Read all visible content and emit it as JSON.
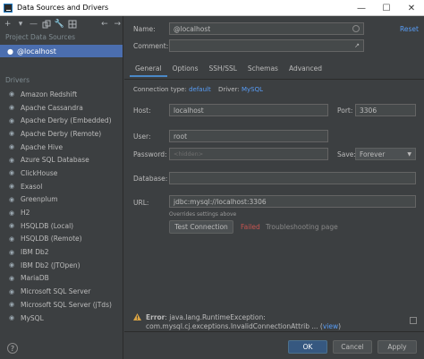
{
  "window": {
    "title": "Data Sources and Drivers"
  },
  "sidebar": {
    "project_label": "Project Data Sources",
    "project_item": "@localhost",
    "drivers_label": "Drivers",
    "drivers": [
      "Amazon Redshift",
      "Apache Cassandra",
      "Apache Derby (Embedded)",
      "Apache Derby (Remote)",
      "Apache Hive",
      "Azure SQL Database",
      "ClickHouse",
      "Exasol",
      "Greenplum",
      "H2",
      "HSQLDB (Local)",
      "HSQLDB (Remote)",
      "IBM Db2",
      "IBM Db2 (JTOpen)",
      "MariaDB",
      "Microsoft SQL Server",
      "Microsoft SQL Server (jTds)",
      "MySQL"
    ]
  },
  "form": {
    "name_label": "Name:",
    "name_value": "@localhost",
    "reset_label": "Reset",
    "comment_label": "Comment:",
    "tabs": [
      "General",
      "Options",
      "SSH/SSL",
      "Schemas",
      "Advanced"
    ],
    "connection_type_label": "Connection type:",
    "connection_type_value": "default",
    "driver_label": "Driver:",
    "driver_value": "MySQL",
    "host_label": "Host:",
    "host_value": "localhost",
    "port_label": "Port:",
    "port_value": "3306",
    "user_label": "User:",
    "user_value": "root",
    "password_label": "Password:",
    "password_placeholder": "<hidden>",
    "save_label": "Save:",
    "save_value": "Forever",
    "database_label": "Database:",
    "url_label": "URL:",
    "url_value": "jdbc:mysql://localhost:3306",
    "url_hint": "Overrides settings above",
    "test_button": "Test Connection",
    "status_failed": "Failed",
    "troubleshooting": "Troubleshooting page"
  },
  "error": {
    "prefix": "Error",
    "line1": ": java.lang.RuntimeException:",
    "line2": "com.mysql.cj.exceptions.InvalidConnectionAttrib ...",
    "view_open": "(",
    "view_link": "view",
    "view_close": ")"
  },
  "footer": {
    "ok": "OK",
    "cancel": "Cancel",
    "apply": "Apply",
    "help": "?"
  }
}
